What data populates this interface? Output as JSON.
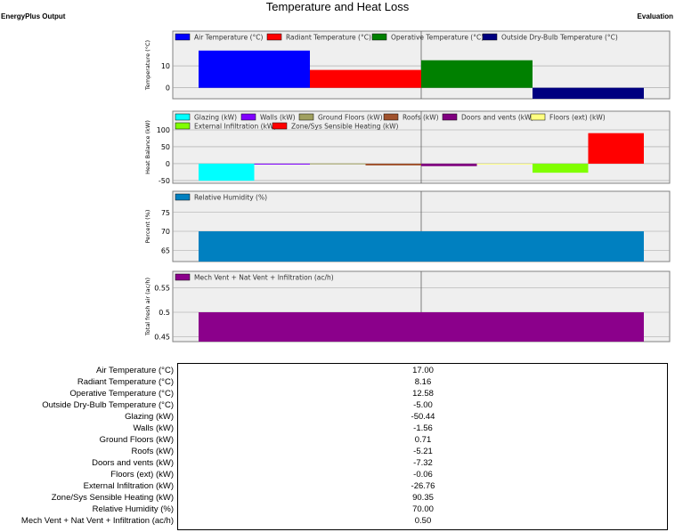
{
  "header": {
    "title": "Temperature and Heat Loss",
    "left": "EnergyPlus Output",
    "right": "Evaluation"
  },
  "charts": [
    {
      "id": "temperature",
      "ylabel": "Temperature (°C)",
      "ticks": [
        0,
        10
      ],
      "ylim": [
        -5,
        21
      ],
      "legend_rows": [
        [
          {
            "label": "Air Temperature (°C)",
            "color": "#0000ff"
          },
          {
            "label": "Radiant Temperature (°C)",
            "color": "#ff0000"
          },
          {
            "label": "Operative Temperature (°C)",
            "color": "#008000"
          },
          {
            "label": "Outside Dry-Bulb Temperature (°C)",
            "color": "#000080"
          }
        ]
      ],
      "bars": [
        {
          "value": 17.0,
          "color": "#0000ff"
        },
        {
          "value": 8.16,
          "color": "#ff0000"
        },
        {
          "value": 12.58,
          "color": "#008000"
        },
        {
          "value": -5.0,
          "color": "#000080"
        }
      ]
    },
    {
      "id": "heat-balance",
      "ylabel": "Heat Balance (kW)",
      "ticks": [
        -50,
        0,
        50,
        100
      ],
      "ylim": [
        -58,
        100
      ],
      "legend_rows": [
        [
          {
            "label": "Glazing (kW)",
            "color": "#00ffff"
          },
          {
            "label": "Walls (kW)",
            "color": "#8000ff"
          },
          {
            "label": "Ground Floors (kW)",
            "color": "#a0a060"
          },
          {
            "label": "Roofs (kW)",
            "color": "#a0522d"
          },
          {
            "label": "Doors and vents (kW)",
            "color": "#800080"
          },
          {
            "label": "Floors (ext) (kW)",
            "color": "#ffff80"
          }
        ],
        [
          {
            "label": "External Infiltration (kW)",
            "color": "#80ff00"
          },
          {
            "label": "Zone/Sys Sensible Heating (kW)",
            "color": "#ff0000"
          }
        ]
      ],
      "bars": [
        {
          "value": -50.44,
          "color": "#00ffff"
        },
        {
          "value": -1.56,
          "color": "#8000ff"
        },
        {
          "value": 0.71,
          "color": "#a0a060"
        },
        {
          "value": -5.21,
          "color": "#a0522d"
        },
        {
          "value": -7.32,
          "color": "#800080"
        },
        {
          "value": -0.06,
          "color": "#ffff80"
        },
        {
          "value": -26.76,
          "color": "#80ff00"
        },
        {
          "value": 90.35,
          "color": "#ff0000"
        }
      ]
    },
    {
      "id": "humidity",
      "ylabel": "Percent (%)",
      "ticks": [
        65,
        70,
        75
      ],
      "ylim": [
        62,
        78
      ],
      "legend_rows": [
        [
          {
            "label": "Relative Humidity (%)",
            "color": "#0080c0"
          }
        ]
      ],
      "bars": [
        {
          "value": 70.0,
          "color": "#0080c0"
        }
      ]
    },
    {
      "id": "ventilation",
      "ylabel": "Total fresh air (ac/h)",
      "ticks": [
        0.45,
        0.5,
        0.55
      ],
      "ylim": [
        0.44,
        0.56
      ],
      "legend_rows": [
        [
          {
            "label": "Mech Vent + Nat Vent + Infiltration (ac/h)",
            "color": "#8b008b"
          }
        ]
      ],
      "bars": [
        {
          "value": 0.5,
          "color": "#8b008b"
        }
      ]
    }
  ],
  "table": [
    {
      "label": "Air Temperature (°C)",
      "value": "17.00"
    },
    {
      "label": "Radiant Temperature (°C)",
      "value": "8.16"
    },
    {
      "label": "Operative Temperature (°C)",
      "value": "12.58"
    },
    {
      "label": "Outside Dry-Bulb Temperature (°C)",
      "value": "-5.00"
    },
    {
      "label": "Glazing (kW)",
      "value": "-50.44"
    },
    {
      "label": "Walls (kW)",
      "value": "-1.56"
    },
    {
      "label": "Ground Floors (kW)",
      "value": "0.71"
    },
    {
      "label": "Roofs (kW)",
      "value": "-5.21"
    },
    {
      "label": "Doors and vents (kW)",
      "value": "-7.32"
    },
    {
      "label": "Floors (ext) (kW)",
      "value": "-0.06"
    },
    {
      "label": "External Infiltration (kW)",
      "value": "-26.76"
    },
    {
      "label": "Zone/Sys Sensible Heating (kW)",
      "value": "90.35"
    },
    {
      "label": "Relative Humidity (%)",
      "value": "70.00"
    },
    {
      "label": "Mech Vent + Nat Vent + Infiltration (ac/h)",
      "value": "0.50"
    }
  ]
}
